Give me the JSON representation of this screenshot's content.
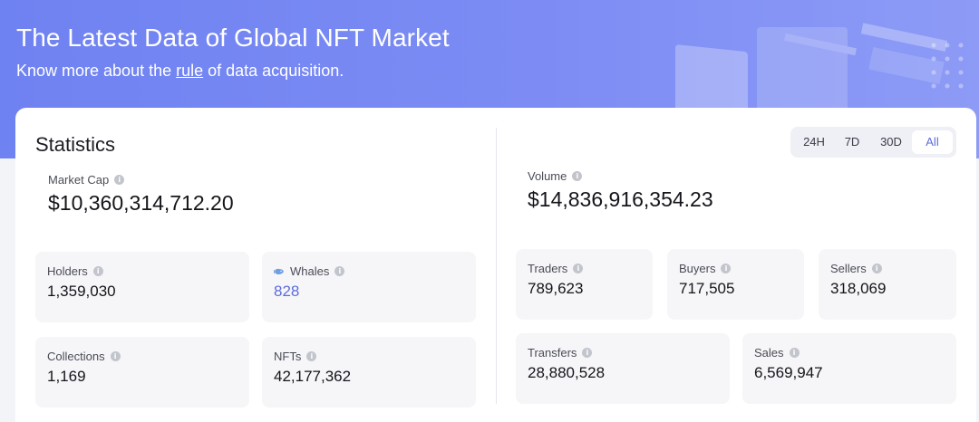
{
  "hero": {
    "title": "The Latest Data of Global NFT Market",
    "subtitle_before": "Know more about the ",
    "subtitle_link": "rule",
    "subtitle_after": " of data acquisition."
  },
  "statistics": {
    "title": "Statistics",
    "market_cap": {
      "label": "Market Cap",
      "value": "$10,360,314,712.20"
    },
    "holders": {
      "label": "Holders",
      "value": "1,359,030"
    },
    "whales": {
      "label": "Whales",
      "value": "828"
    },
    "collections": {
      "label": "Collections",
      "value": "1,169"
    },
    "nfts": {
      "label": "NFTs",
      "value": "42,177,362"
    }
  },
  "period_tabs": {
    "items": [
      "24H",
      "7D",
      "30D",
      "All"
    ],
    "selected": "All"
  },
  "activity": {
    "volume": {
      "label": "Volume",
      "value": "$14,836,916,354.23"
    },
    "traders": {
      "label": "Traders",
      "value": "789,623"
    },
    "buyers": {
      "label": "Buyers",
      "value": "717,505"
    },
    "sellers": {
      "label": "Sellers",
      "value": "318,069"
    },
    "transfers": {
      "label": "Transfers",
      "value": "28,880,528"
    },
    "sales": {
      "label": "Sales",
      "value": "6,569,947"
    }
  },
  "colors": {
    "hero_gradient_start": "#6f82f1",
    "accent": "#5e6cdc",
    "tile_bg": "#f6f6f8"
  },
  "icons": {
    "info": "info-circle-icon",
    "whale": "whale-icon"
  }
}
